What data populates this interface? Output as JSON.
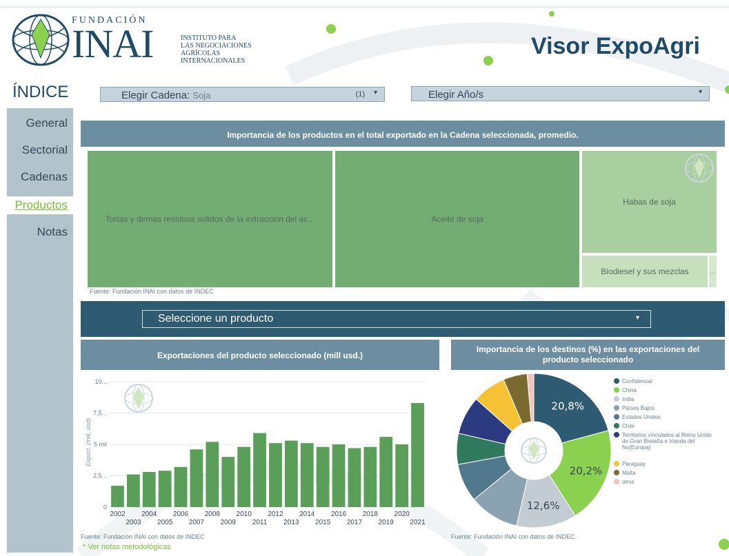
{
  "header": {
    "org_name": "FUNDACIÓN",
    "org_acronym": "INAI",
    "org_sub_1": "INSTITUTO PARA",
    "org_sub_2": "LAS NEGOCIACIONES",
    "org_sub_3": "AGRÍCOLAS",
    "org_sub_4": "INTERNACIONALES",
    "app_title": "Visor ExpoAgri"
  },
  "sidebar": {
    "title": "ÍNDICE",
    "items": [
      {
        "label": "General"
      },
      {
        "label": "Sectorial"
      },
      {
        "label": "Cadenas"
      },
      {
        "label": "Productos"
      },
      {
        "label": "Notas"
      }
    ]
  },
  "filters": {
    "cadena_label": "Elegir Cadena:",
    "cadena_value": "Soja",
    "cadena_count": "(1)",
    "anio_label": "Elegir Año/s"
  },
  "treemap": {
    "title": "Importancia de los productos en el total exportado en la Cadena seleccionada, promedio.",
    "items": [
      {
        "label": "Tortas y demas residuos solidos de la extraccion del ac..."
      },
      {
        "label": "Aceite de soja"
      },
      {
        "label": "Habas de soja"
      },
      {
        "label": "Biodiesel y sus mezclas"
      }
    ],
    "more": "...",
    "source": "Fuente: Fundación INAI con datos de INDEC"
  },
  "product_selector": {
    "label": "Seleccione un producto"
  },
  "chart_data": [
    {
      "type": "bar",
      "title": "Exportaciones del producto seleccionado (mill usd.)",
      "ylabel": "Export. (mill. usd)",
      "x": [
        2002,
        2003,
        2004,
        2005,
        2006,
        2007,
        2008,
        2009,
        2010,
        2011,
        2012,
        2013,
        2014,
        2015,
        2016,
        2017,
        2018,
        2019,
        2020,
        2021
      ],
      "values": [
        1.7,
        2.6,
        2.8,
        2.9,
        3.2,
        4.6,
        5.2,
        4.0,
        4.8,
        5.9,
        5.1,
        5.3,
        5.1,
        4.8,
        5.0,
        4.7,
        4.8,
        5.6,
        5.0,
        8.3
      ],
      "ylim": [
        0,
        10
      ],
      "yticks": [
        "0",
        "2,5...",
        "5 mil",
        "7,5...",
        "10..."
      ],
      "xticks_top": [
        "2002",
        "2004",
        "2006",
        "2008",
        "2010",
        "2012",
        "2014",
        "2016",
        "2018",
        "2020"
      ],
      "xticks_bottom": [
        "2003",
        "2005",
        "2007",
        "2009",
        "2011",
        "2013",
        "2015",
        "2017",
        "2019",
        "2021"
      ],
      "source": "Fuente: Fundación INAI con datos de INDEC",
      "color": "#5a9e5a"
    },
    {
      "type": "pie",
      "title_1": "Importancia de los destinos (%) en las exportaciones del",
      "title_2": "producto seleccionado",
      "labels": [
        "Confidencial",
        "China",
        "India",
        "Países Bajos",
        "Estados Unidos",
        "Chile",
        "Territorios vinculados al Reino Unido de Gran Bretaña e Irlanda del No(Europa)",
        "Paraguay",
        "Malta",
        "otros"
      ],
      "values": [
        20.8,
        20.2,
        12.6,
        10.5,
        8.0,
        6.5,
        8.0,
        7.0,
        5.0,
        1.4
      ],
      "colors": [
        "#2e5b72",
        "#8bd04f",
        "#c3ccd3",
        "#8aa2b2",
        "#51788c",
        "#2f7a5e",
        "#2c3a80",
        "#f5c135",
        "#7a6a30",
        "#f2c4bf"
      ],
      "data_labels": [
        "20,8%",
        "20,2%",
        "12,6%"
      ],
      "legend": "right",
      "source": "Fuente: Fundación INAI con datos de INDEC"
    }
  ],
  "footer": {
    "notes_link": "* Ver notas metodológicas"
  },
  "colors": {
    "primary": "#1f4a68",
    "accent": "#7cbb3a",
    "panel_header": "#6d8ea0",
    "treemap_main": "#73ad73",
    "treemap_light": "#a9cfa0"
  }
}
